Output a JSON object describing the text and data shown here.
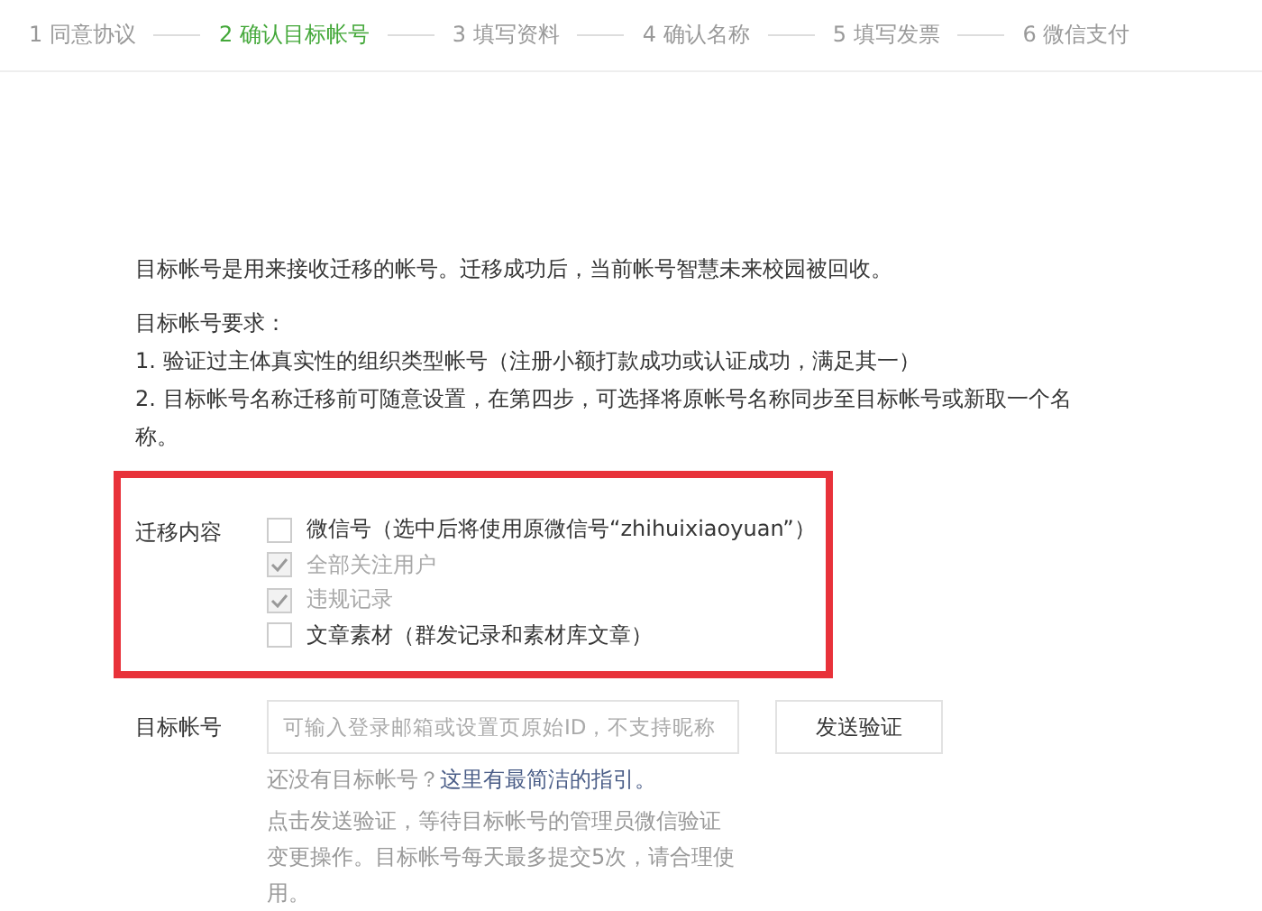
{
  "steps": [
    {
      "label": "1 同意协议",
      "selected": false
    },
    {
      "label": "2 确认目标帐号",
      "selected": true
    },
    {
      "label": "3 填写资料",
      "selected": false
    },
    {
      "label": "4 确认名称",
      "selected": false
    },
    {
      "label": "5 填写发票",
      "selected": false
    },
    {
      "label": "6 微信支付",
      "selected": false
    }
  ],
  "intro": "目标帐号是用来接收迁移的帐号。迁移成功后，当前帐号智慧未来校园被回收。",
  "requirements": {
    "title": "目标帐号要求：",
    "items": [
      "1. 验证过主体真实性的组织类型帐号（注册小额打款成功或认证成功，满足其一）",
      "2. 目标帐号名称迁移前可随意设置，在第四步，可选择将原帐号名称同步至目标帐号或新取一个名称。"
    ]
  },
  "migrate": {
    "label": "迁移内容",
    "options": [
      {
        "label": "微信号（选中后将使用原微信号“zhihuixiaoyuan”）",
        "checked": false,
        "disabled": false
      },
      {
        "label": "全部关注用户",
        "checked": true,
        "disabled": true
      },
      {
        "label": "违规记录",
        "checked": true,
        "disabled": true
      },
      {
        "label": "文章素材（群发记录和素材库文章）",
        "checked": false,
        "disabled": false
      }
    ]
  },
  "target": {
    "label": "目标帐号",
    "placeholder": "可输入登录邮箱或设置页原始ID，不支持昵称",
    "button": "发送验证",
    "question": "还没有目标帐号？",
    "link": "这里有最简洁的指引。",
    "note": "点击发送验证，等待目标帐号的管理员微信验证变更操作。目标帐号每天最多提交5次，请合理使用。"
  }
}
